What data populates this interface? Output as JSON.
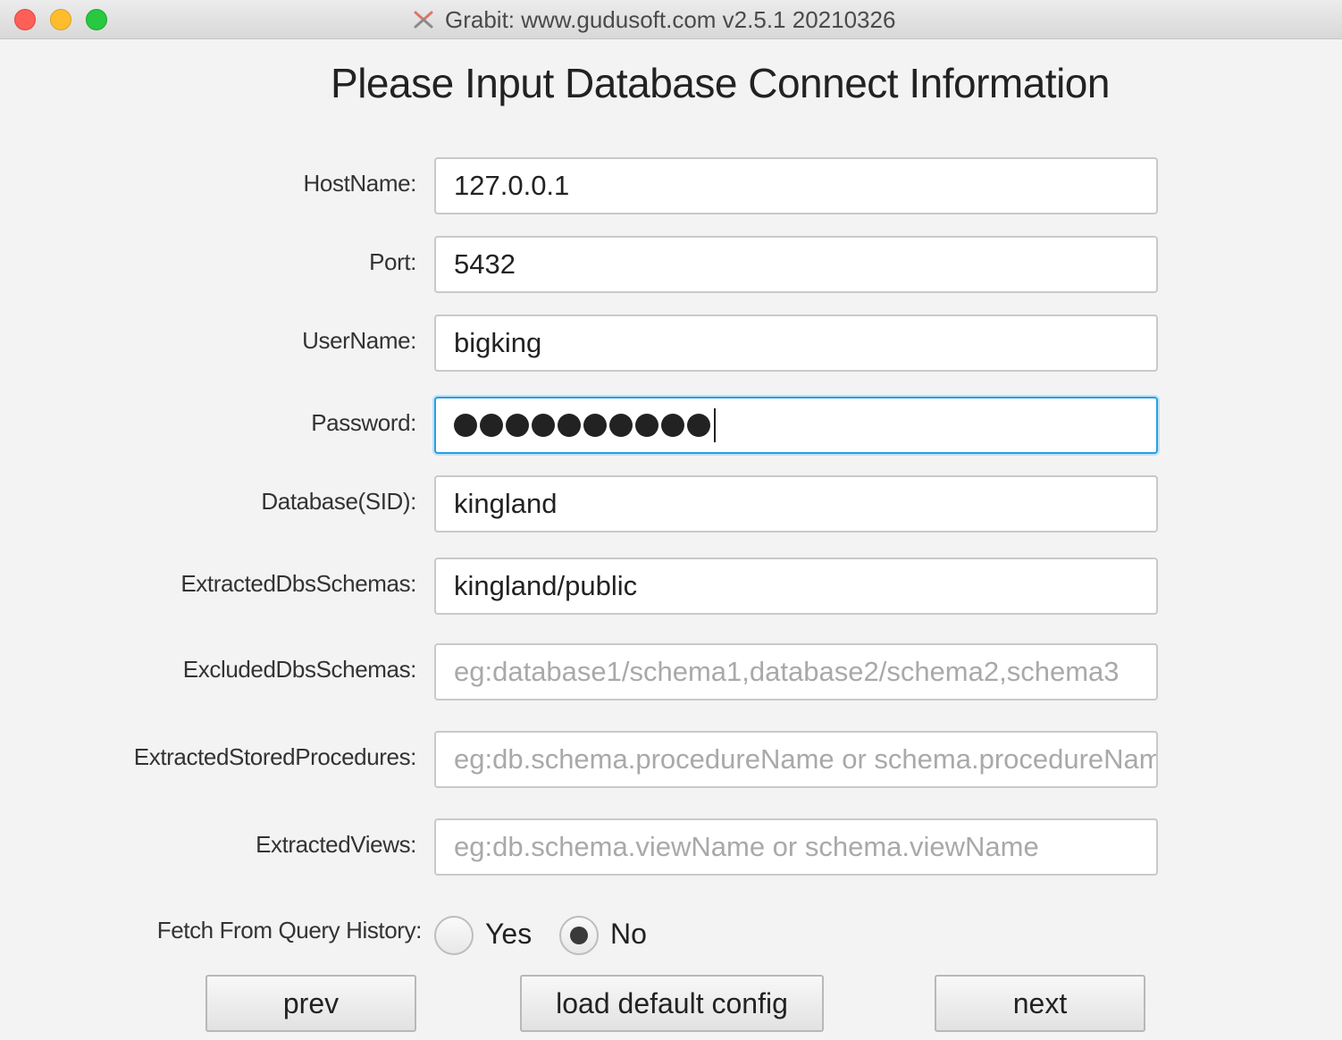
{
  "window": {
    "title": "Grabit: www.gudusoft.com  v2.5.1 20210326"
  },
  "heading": "Please Input Database Connect Information",
  "fields": {
    "hostname": {
      "label": "HostName:",
      "value": "127.0.0.1"
    },
    "port": {
      "label": "Port:",
      "value": "5432"
    },
    "username": {
      "label": "UserName:",
      "value": "bigking"
    },
    "password": {
      "label": "Password:",
      "masked_length": 10
    },
    "database": {
      "label": "Database(SID):",
      "value": "kingland"
    },
    "extracted_schemas": {
      "label": "ExtractedDbsSchemas:",
      "value": "kingland/public"
    },
    "excluded_schemas": {
      "label": "ExcludedDbsSchemas:",
      "placeholder": "eg:database1/schema1,database2/schema2,schema3"
    },
    "stored_procedures": {
      "label": "ExtractedStoredProcedures:",
      "placeholder": "eg:db.schema.procedureName or schema.procedureName"
    },
    "views": {
      "label": "ExtractedViews:",
      "placeholder": "eg:db.schema.viewName or schema.viewName"
    }
  },
  "query_history": {
    "label": "Fetch From Query History:",
    "options": [
      "Yes",
      "No"
    ],
    "selected": "No"
  },
  "buttons": {
    "prev": "prev",
    "load_default": "load default config",
    "next": "next"
  }
}
